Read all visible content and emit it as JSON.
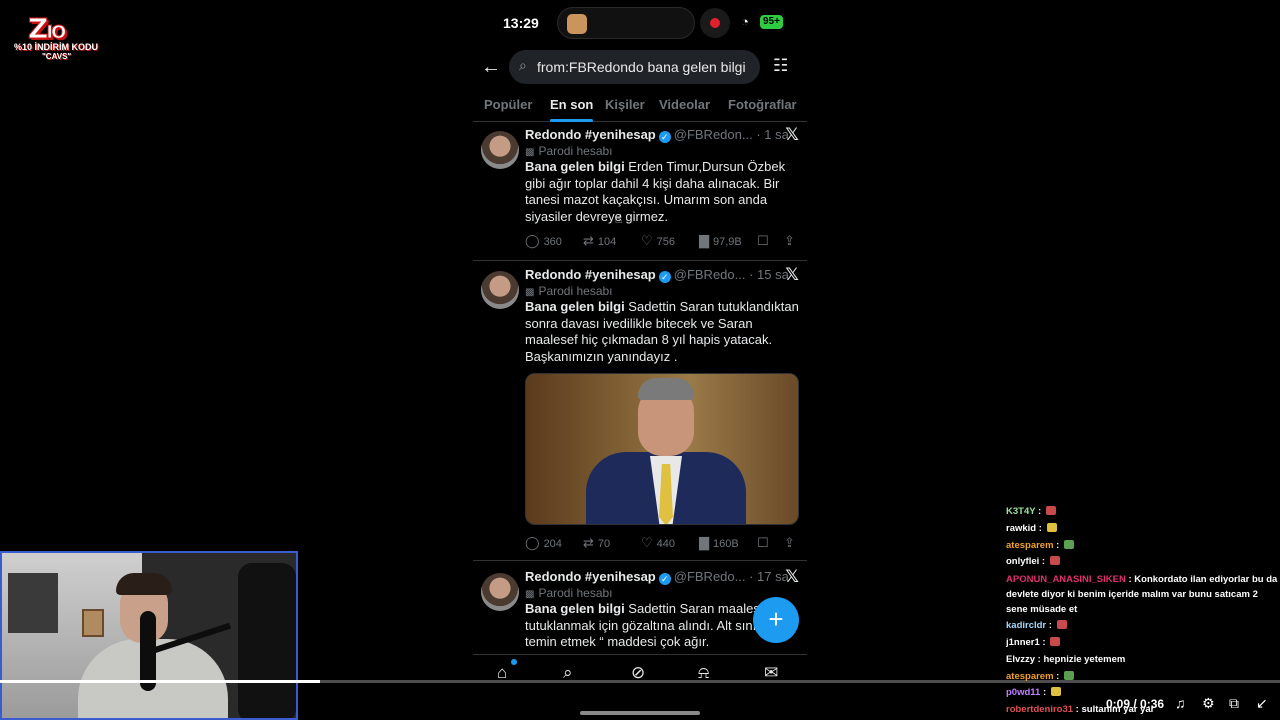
{
  "watermark": {
    "logo_text": "ZIO",
    "subtitle": "%10 İNDİRİM KODU",
    "code": "\"CAVS\""
  },
  "phone": {
    "status": {
      "time": "13:29",
      "battery": "95+"
    },
    "search": {
      "query": "from:FBRedondo bana gelen bilgi"
    },
    "tabs": [
      {
        "label": "Popüler",
        "active": false
      },
      {
        "label": "En son",
        "active": true
      },
      {
        "label": "Kişiler",
        "active": false
      },
      {
        "label": "Videolar",
        "active": false
      },
      {
        "label": "Fotoğraflar",
        "active": false
      }
    ],
    "tweets": [
      {
        "name": "Redondo #yenihesap",
        "handle": "@FBRedon...",
        "time": "· 1 sa",
        "parody_label": "Parodi hesabı",
        "bold_lead": "Bana gelen bilgi",
        "text": " Erden Timur,Dursun Özbek gibi ağır toplar dahil 4 kişi daha alınacak. Bir tanesi mazot kaçakçısı. Umarım son anda siyasiler devreye girmez.",
        "replies": "360",
        "retweets": "104",
        "likes": "756",
        "views": "97,9B"
      },
      {
        "name": "Redondo #yenihesap",
        "handle": "@FBRedo...",
        "time": "· 15 sa",
        "parody_label": "Parodi hesabı",
        "bold_lead": "Bana gelen bilgi",
        "text": " Sadettin Saran tutuklandıktan sonra davası ivedilikle bitecek ve Saran maalesef hiç çıkmadan 8 yıl hapis yatacak. Başkanımızın yanındayız .",
        "replies": "204",
        "retweets": "70",
        "likes": "440",
        "views": "160B"
      },
      {
        "name": "Redondo #yenihesap",
        "handle": "@FBRedo...",
        "time": "· 17 sa",
        "parody_label": "Parodi hesabı",
        "bold_lead": "Bana gelen bilgi",
        "text": " Sadettin Saran maalesef tutuklanmak için gözaltına alındı. Alt sınır olan “ temin etmek “ maddesi çok ağır."
      }
    ]
  },
  "video": {
    "time_display": "0:09 / 0:36",
    "progress": 0.25
  },
  "chat": {
    "messages": [
      {
        "user": "K3T4Y",
        "color": "#9be39b",
        "text": "",
        "emote_color": "#c94a4a"
      },
      {
        "user": "rawkid",
        "color": "#ffffff",
        "text": "",
        "emote_color": "#e0c040"
      },
      {
        "user": "atesparem",
        "color": "#f0a030",
        "text": "",
        "emote_color": "#5aa050"
      },
      {
        "user": "onlyflei",
        "color": "#ffffff",
        "text": "",
        "emote_color": "#c94a4a"
      },
      {
        "user": "APONUN_ANASINI_SIKEN",
        "color": "#e03070",
        "text": "Konkordato ilan ediyorlar bu da devlete diyor ki benim içeride malım var bunu satıcam 2 sene müsade et",
        "emote_color": ""
      },
      {
        "user": "kadircldr",
        "color": "#a0d8ff",
        "text": "",
        "emote_color": "#c94a4a"
      },
      {
        "user": "j1nner1",
        "color": "#ffffff",
        "text": "",
        "emote_color": "#c94a4a"
      },
      {
        "user": "Elvzzy",
        "color": "#ffffff",
        "text": "hepnizie yetemem",
        "emote_color": ""
      },
      {
        "user": "atesparem",
        "color": "#f0a030",
        "text": "",
        "emote_color": "#5aa050"
      },
      {
        "user": "p0wd11",
        "color": "#c080ff",
        "text": "",
        "emote_color": "#e0c040"
      },
      {
        "user": "robertdeniro31",
        "color": "#e05050",
        "text": "sultanım yar yar",
        "emote_color": ""
      }
    ]
  }
}
